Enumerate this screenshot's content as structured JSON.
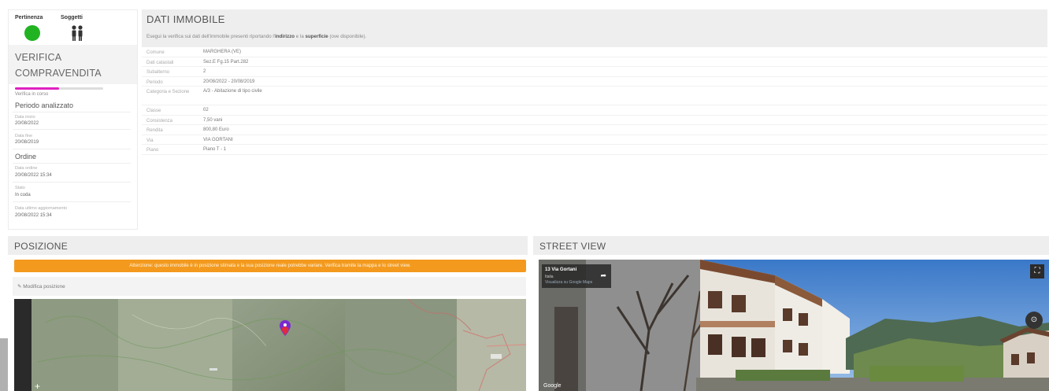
{
  "left": {
    "status_labels": [
      "Pertinenza",
      "Soggetti"
    ],
    "verifica_title": [
      "VERIFICA",
      "COMPRAVENDITA"
    ],
    "progress": 0.5,
    "progress_caption": "Verifica in corso",
    "periodo": {
      "title": "Periodo analizzato",
      "data_inizio_label": "Data inizio",
      "data_inizio": "20/08/2022",
      "data_fine_label": "Data fine",
      "data_fine": "20/08/2019"
    },
    "ordine": {
      "title": "Ordine",
      "data_ordine_label": "Data ordine",
      "data_ordine": "20/08/2022 15:34",
      "stato_label": "Stato",
      "stato": "In coda",
      "data_ultimo_label": "Data ultimo aggiornamento",
      "data_ultimo": "20/08/2022 15:34"
    }
  },
  "dati": {
    "title": "DATI IMMOBILE",
    "desc_prefix": "Esegui la verifica sui dati dell'immobile presenti riportando l'",
    "desc_b1": "indirizzo",
    "desc_mid": " e la ",
    "desc_b2": "superficie",
    "desc_suffix": " (ove disponibile).",
    "rows": [
      {
        "k": "Comune",
        "v": "MARGHERA (VE)"
      },
      {
        "k": "Dati catastali",
        "v": "Sez.E Fg.15 Part.282"
      },
      {
        "k": "Subalterno",
        "v": "2"
      },
      {
        "k": "Periodo",
        "v": "20/08/2022 - 20/08/2019"
      },
      {
        "k": "Categoria e Sezione",
        "v": "A/3 - Abitazione di tipo civile"
      },
      {
        "k": "Classe",
        "v": "02"
      },
      {
        "k": "Consistenza",
        "v": "7,50 vani"
      },
      {
        "k": "Rendita",
        "v": "800,80 Euro"
      },
      {
        "k": "Via",
        "v": "VIA GORTANI"
      },
      {
        "k": "Piano",
        "v": "Piano T - 1"
      }
    ]
  },
  "posizione": {
    "title": "POSIZIONE",
    "alert": "Attenzione: questo immobile è in posizione stimata e la sua posizione reale potrebbe variare. Verifica tramite la mappa e lo street view.",
    "modifica_label": "Modifica posizione",
    "zoom_label": "+"
  },
  "street_view": {
    "title": "STREET VIEW",
    "card_title": "13 Via Gortani",
    "card_sub": "Italia",
    "card_link": "Visualizza su Google Maps",
    "google_label": "Google",
    "fullscreen_label": "⛶",
    "compass_label": "⊙"
  },
  "colors": {
    "status_green": "#22b322",
    "progress_magenta": "#e020c0",
    "alert_orange": "#f39a1e"
  }
}
